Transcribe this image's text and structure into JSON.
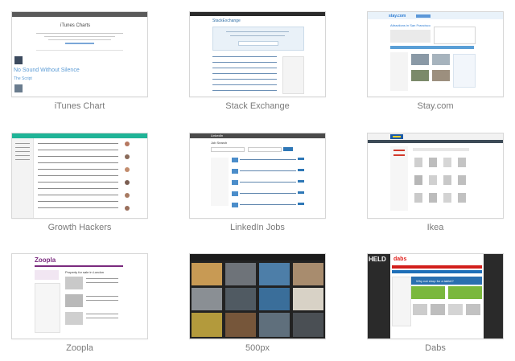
{
  "gallery": {
    "items": [
      {
        "caption": "iTunes Chart"
      },
      {
        "caption": "Stack Exchange"
      },
      {
        "caption": "Stay.com"
      },
      {
        "caption": "Growth Hackers"
      },
      {
        "caption": "LinkedIn Jobs"
      },
      {
        "caption": "Ikea"
      },
      {
        "caption": "Zoopla"
      },
      {
        "caption": "500px"
      },
      {
        "caption": "Dabs"
      }
    ]
  },
  "thumbs": {
    "itunes": {
      "title": "iTunes Charts",
      "headline": "No Sound Without Silence",
      "sub": "The Script"
    },
    "stackexchange": {
      "logo": "StackExchange"
    },
    "stay": {
      "logo": "stay.com",
      "heading": "Attractions in San Francisco"
    },
    "linkedin": {
      "logo": "LinkedIn",
      "heading": "Job Search"
    },
    "zoopla": {
      "logo": "Zoopla",
      "heading": "Property for sale in London"
    },
    "dabs": {
      "logo": "dabs",
      "banner": "Why not shop for a tablet?",
      "promo": "HELD"
    }
  }
}
